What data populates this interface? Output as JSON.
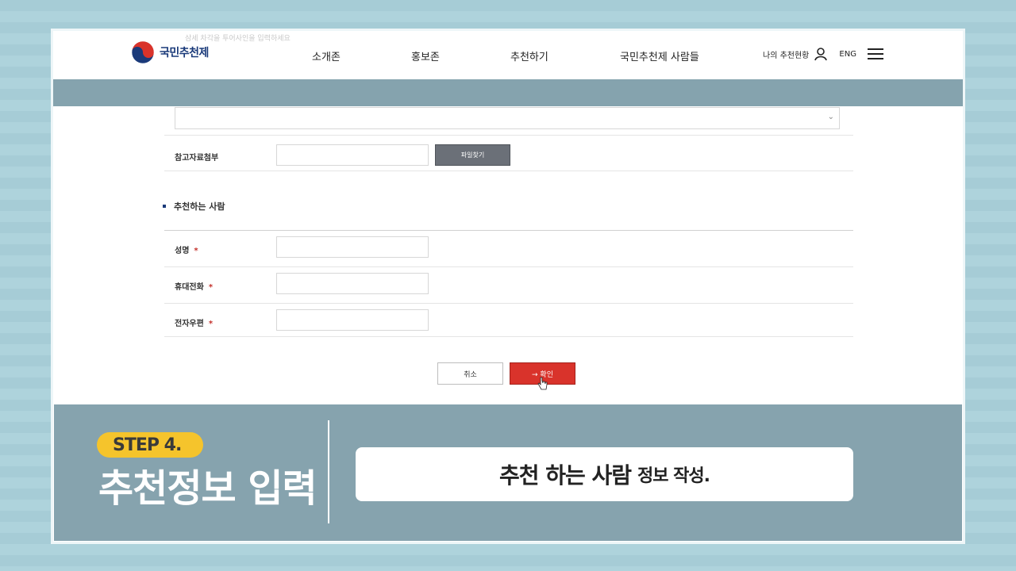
{
  "header": {
    "logo_text": "국민추천제",
    "ghost_text": "삼세 차각을 투어사인을 입력하세요",
    "nav": [
      "소개존",
      "홍보존",
      "추천하기",
      "국민추천제 사람들"
    ],
    "my_status": "나의 추천현황",
    "lang": "ENG"
  },
  "form": {
    "attachment_label": "참고자료첨부",
    "file_button": "파일찾기",
    "section_title": "추천하는 사람",
    "fields": [
      {
        "label": "성명",
        "required_mark": "*"
      },
      {
        "label": "휴대전화",
        "required_mark": "*"
      },
      {
        "label": "전자우편",
        "required_mark": "*"
      }
    ],
    "cancel_label": "취소",
    "confirm_label": "→  확인"
  },
  "caption": {
    "step": "STEP 4.",
    "title": "추천정보 입력",
    "main": "추천 하는 사람",
    "sub": "정보 작성."
  },
  "colors": {
    "confirm": "#d9332b",
    "band": "#86a3ae",
    "pill": "#f5c42c"
  }
}
